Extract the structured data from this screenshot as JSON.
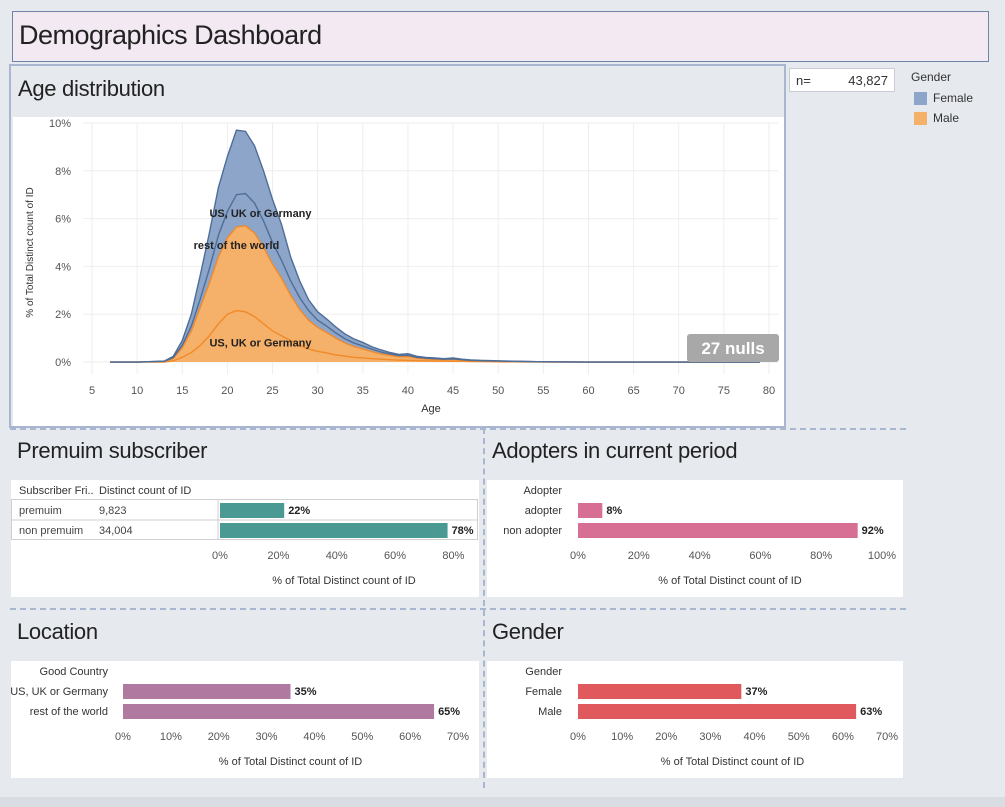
{
  "header": {
    "title": "Demographics Dashboard"
  },
  "n_box": {
    "label": "n=",
    "value": "43,827"
  },
  "legend": {
    "title": "Gender",
    "items": [
      {
        "label": "Female",
        "color": "#8ca5c8"
      },
      {
        "label": "Male",
        "color": "#f5b069"
      }
    ]
  },
  "colors": {
    "female_stroke": "#4e6e99",
    "male_stroke": "#f08a2a",
    "premium": "#4a9a93",
    "adopter": "#d66f93",
    "location": "#b07aa0",
    "gender": "#e05a5d"
  },
  "chart_data": [
    {
      "type": "area",
      "title": "Age distribution",
      "xlabel": "Age",
      "ylabel": "% of Total Distinct count of ID",
      "xlim": [
        4,
        81
      ],
      "ylim": [
        -0.5,
        10
      ],
      "x_ticks": [
        "5",
        "10",
        "15",
        "20",
        "25",
        "30",
        "35",
        "40",
        "45",
        "50",
        "55",
        "60",
        "65",
        "70",
        "75",
        "80"
      ],
      "y_ticks": [
        "0%",
        "2%",
        "4%",
        "6%",
        "8%",
        "10%"
      ],
      "stacked": true,
      "x": [
        7,
        10,
        13,
        14,
        15,
        16,
        17,
        18,
        19,
        20,
        21,
        22,
        23,
        24,
        25,
        26,
        27,
        28,
        29,
        30,
        31,
        32,
        33,
        34,
        35,
        36,
        37,
        38,
        39,
        40,
        41,
        42,
        43,
        44,
        45,
        46,
        47,
        48,
        50,
        55,
        60,
        65,
        70,
        75,
        79
      ],
      "series": [
        {
          "name": "US, UK or Germany",
          "group": "Male",
          "values": [
            0,
            0,
            0,
            0.05,
            0.2,
            0.4,
            0.7,
            1.1,
            1.6,
            2.0,
            2.15,
            2.1,
            1.9,
            1.6,
            1.3,
            1.1,
            0.9,
            0.7,
            0.55,
            0.45,
            0.38,
            0.3,
            0.25,
            0.2,
            0.17,
            0.14,
            0.12,
            0.1,
            0.08,
            0.07,
            0.06,
            0.05,
            0.04,
            0.04,
            0.03,
            0.03,
            0.02,
            0.02,
            0.01,
            0,
            0,
            0,
            0,
            0,
            0
          ]
        },
        {
          "name": "rest of the world",
          "group": "Male",
          "values": [
            0,
            0,
            0.02,
            0.1,
            0.4,
            0.9,
            1.6,
            2.2,
            2.8,
            3.2,
            3.5,
            3.6,
            3.5,
            3.2,
            2.8,
            2.4,
            1.9,
            1.5,
            1.2,
            1.0,
            0.85,
            0.7,
            0.55,
            0.45,
            0.38,
            0.3,
            0.22,
            0.18,
            0.14,
            0.16,
            0.1,
            0.08,
            0.07,
            0.06,
            0.08,
            0.05,
            0.04,
            0.03,
            0.02,
            0.01,
            0,
            0,
            0,
            0,
            0
          ]
        },
        {
          "name": "US, UK or Germany",
          "group": "Female",
          "values": [
            0,
            0,
            0.01,
            0.04,
            0.1,
            0.2,
            0.35,
            0.6,
            0.9,
            1.1,
            1.35,
            1.35,
            1.25,
            1.1,
            0.9,
            0.75,
            0.6,
            0.5,
            0.4,
            0.3,
            0.27,
            0.22,
            0.18,
            0.15,
            0.12,
            0.1,
            0.08,
            0.06,
            0.05,
            0.05,
            0.04,
            0.03,
            0.03,
            0.02,
            0.02,
            0.02,
            0.01,
            0.01,
            0.01,
            0,
            0,
            0,
            0,
            0,
            0
          ]
        },
        {
          "name": "rest of the world",
          "group": "Female",
          "values": [
            0,
            0,
            0.01,
            0.05,
            0.2,
            0.5,
            1.0,
            1.5,
            2.0,
            2.3,
            2.7,
            2.6,
            2.4,
            2.1,
            1.8,
            1.5,
            1.0,
            0.7,
            0.45,
            0.35,
            0.3,
            0.25,
            0.2,
            0.17,
            0.15,
            0.1,
            0.09,
            0.06,
            0.05,
            0.07,
            0.04,
            0.03,
            0.03,
            0.02,
            0.04,
            0.02,
            0.02,
            0.01,
            0.01,
            0,
            0,
            0,
            0,
            0,
            0
          ]
        }
      ],
      "annotations": [
        "rest of the world",
        "US, UK or Germany",
        "rest of the world",
        "US, UK or Germany"
      ],
      "nulls_badge": "27 nulls"
    },
    {
      "type": "bar",
      "title": "Premuim subscriber",
      "table_headers": [
        "Subscriber Fri..",
        "Distinct count of ID"
      ],
      "categories": [
        "premuim",
        "non premuim"
      ],
      "counts": [
        "9,823",
        "34,004"
      ],
      "values": [
        22,
        78
      ],
      "value_labels": [
        "22%",
        "78%"
      ],
      "xlim": [
        0,
        85
      ],
      "x_ticks": [
        0,
        20,
        40,
        60,
        80
      ],
      "x_tick_labels": [
        "0%",
        "20%",
        "40%",
        "60%",
        "80%"
      ],
      "xlabel": "% of Total Distinct count of ID"
    },
    {
      "type": "bar",
      "title": "Adopters in current period",
      "row_header": "Adopter",
      "categories": [
        "adopter",
        "non adopter"
      ],
      "values": [
        8,
        92
      ],
      "value_labels": [
        "8%",
        "92%"
      ],
      "xlim": [
        0,
        100
      ],
      "x_ticks": [
        0,
        20,
        40,
        60,
        80,
        100
      ],
      "x_tick_labels": [
        "0%",
        "20%",
        "40%",
        "60%",
        "80%",
        "100%"
      ],
      "xlabel": "% of Total Distinct count of ID"
    },
    {
      "type": "bar",
      "title": "Location",
      "row_header": "Good Country",
      "categories": [
        "US, UK or Germany",
        "rest of the world"
      ],
      "values": [
        35,
        65
      ],
      "value_labels": [
        "35%",
        "65%"
      ],
      "xlim": [
        0,
        70
      ],
      "x_ticks": [
        0,
        10,
        20,
        30,
        40,
        50,
        60,
        70
      ],
      "x_tick_labels": [
        "0%",
        "10%",
        "20%",
        "30%",
        "40%",
        "50%",
        "60%",
        "70%"
      ],
      "xlabel": "% of Total Distinct count of ID"
    },
    {
      "type": "bar",
      "title": "Gender",
      "row_header": "Gender",
      "categories": [
        "Female",
        "Male"
      ],
      "values": [
        37,
        63
      ],
      "value_labels": [
        "37%",
        "63%"
      ],
      "xlim": [
        0,
        70
      ],
      "x_ticks": [
        0,
        10,
        20,
        30,
        40,
        50,
        60,
        70
      ],
      "x_tick_labels": [
        "0%",
        "10%",
        "20%",
        "30%",
        "40%",
        "50%",
        "60%",
        "70%"
      ],
      "xlabel": "% of Total Distinct count of ID"
    }
  ]
}
